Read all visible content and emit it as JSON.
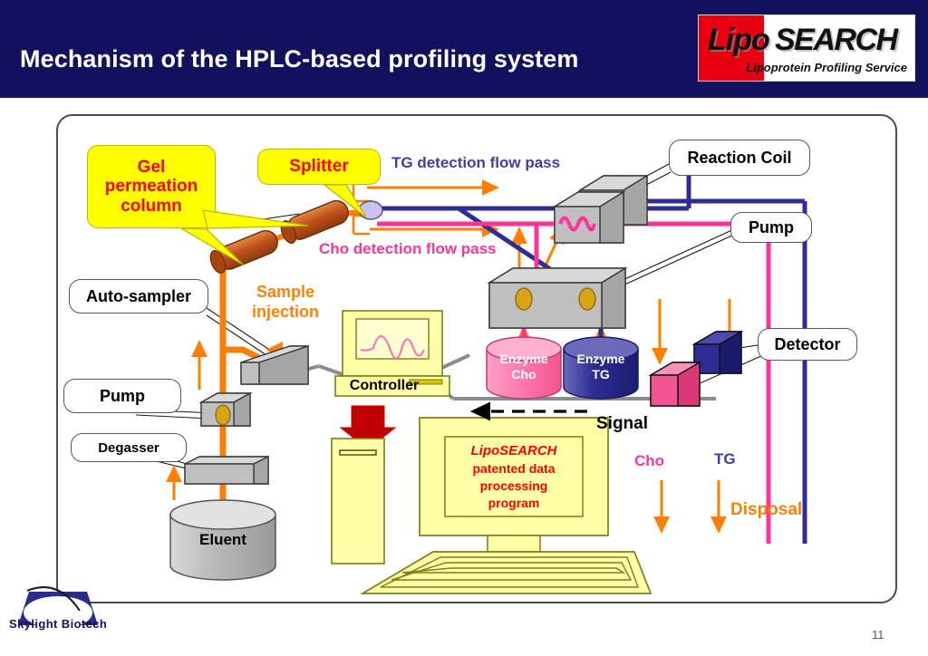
{
  "header": {
    "title": "Mechanism of the HPLC-based profiling system",
    "bg_color": "#11115e",
    "logo": {
      "word_1": "Lipo",
      "word_2": "SEARCH",
      "tagline": "Lipoprotein Profiling Service",
      "accent_color": "#e60012"
    }
  },
  "diagram": {
    "callouts": [
      {
        "id": "gel-permeation-column",
        "label": "Gel\npermeation\ncolumn",
        "style": "yellow",
        "text_color": "#ff0000"
      },
      {
        "id": "splitter",
        "label": "Splitter",
        "style": "yellow",
        "text_color": "#ff0000"
      },
      {
        "id": "reaction-coil",
        "label": "Reaction Coil",
        "style": "white",
        "text_color": "#000000"
      },
      {
        "id": "pump-right",
        "label": "Pump",
        "style": "white",
        "text_color": "#000000"
      },
      {
        "id": "detector",
        "label": "Detector",
        "style": "white",
        "text_color": "#000000"
      },
      {
        "id": "auto-sampler",
        "label": "Auto-sampler",
        "style": "white",
        "text_color": "#000000"
      },
      {
        "id": "pump-left",
        "label": "Pump",
        "style": "white",
        "text_color": "#000000"
      },
      {
        "id": "degasser",
        "label": "Degasser",
        "style": "white",
        "text_color": "#000000"
      }
    ],
    "flow_labels": {
      "tg_flow": "TG detection flow pass",
      "tg_flow_color": "#3f3fa0",
      "cho_flow": "Cho detection flow pass",
      "cho_flow_color": "#ff3399",
      "sample_injection": "Sample\ninjection",
      "sample_injection_color": "#ff8000",
      "signal": "Signal",
      "signal_color": "#000000",
      "cho": "Cho",
      "cho_color": "#ff3399",
      "tg": "TG",
      "tg_color": "#3f3fa0",
      "disposal": "Disposal",
      "disposal_color": "#ff8000"
    },
    "vessels": {
      "eluent": "Eluent",
      "enzyme_cho_line1": "Enzyme",
      "enzyme_cho_line2": "Cho",
      "enzyme_tg_line1": "Enzyme",
      "enzyme_tg_line2": "TG"
    },
    "computers": {
      "controller_label": "Controller",
      "program_line1": "LipoSEARCH",
      "program_line2": "patented data",
      "program_line3": "processing",
      "program_line4": "program",
      "program_text_color": "#ff0000"
    },
    "palette": {
      "orange_flow": "#ff7f00",
      "pink_flow": "#ff3399",
      "blue_flow": "#2d2d94",
      "column_brown": "#c0521a",
      "grey_box": "#bfbfbf",
      "yellow_device": "#ffffa8",
      "red_arrow": "#c00000"
    }
  },
  "footer": {
    "company": "Skylight  Biotech",
    "page_number": "11"
  }
}
